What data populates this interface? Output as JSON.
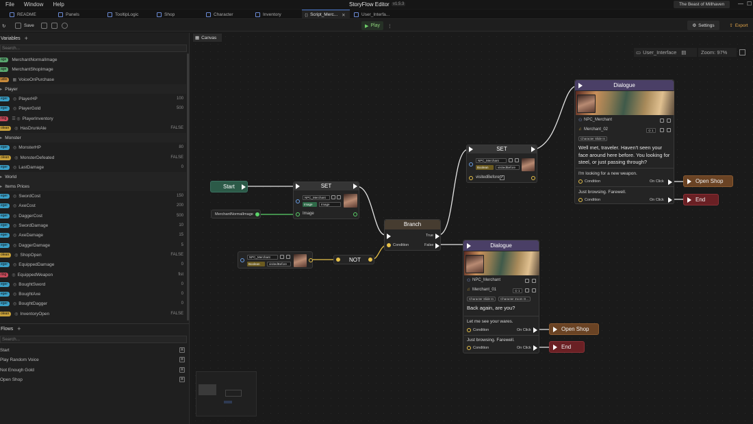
{
  "menu": {
    "file": "File",
    "window": "Window",
    "help": "Help"
  },
  "app": {
    "title": "StoryFlow Editor",
    "version": "v1.5.3",
    "project": "The Beast of Millhaven"
  },
  "tabs": [
    "README",
    "Panels",
    "TooltipLogic",
    "Shop",
    "Character",
    "Inventory",
    "Script_Merc...",
    "User_Interfa..."
  ],
  "toolbar": {
    "save": "Save",
    "play": "Play",
    "settings": "Settings",
    "export": "Export"
  },
  "variables": {
    "title": "Variables",
    "search": "Search...",
    "ungrouped": [
      {
        "type": "age",
        "name": "MerchantNormalImage",
        "value": ""
      },
      {
        "type": "age",
        "name": "MerchantShopImage",
        "value": ""
      },
      {
        "type": "udio",
        "name": "VoiceOnPurchase",
        "value": ""
      }
    ],
    "groups": [
      {
        "name": "Player",
        "items": [
          {
            "type": "eger",
            "name": "PlayerHP",
            "value": "100"
          },
          {
            "type": "eger",
            "name": "PlayerGold",
            "value": "500"
          },
          {
            "type": "ring",
            "name": "PlayerInventory",
            "value": ""
          },
          {
            "type": "olean",
            "name": "HasDrunkAle",
            "value": "FALSE"
          }
        ]
      },
      {
        "name": "Monster",
        "items": [
          {
            "type": "eger",
            "name": "MonsterHP",
            "value": "80"
          },
          {
            "type": "olean",
            "name": "MonsterDefeated",
            "value": "FALSE"
          },
          {
            "type": "eger",
            "name": "LastDamage",
            "value": "0"
          }
        ]
      },
      {
        "name": "World",
        "items": []
      },
      {
        "name": "Items Prices",
        "items": [
          {
            "type": "eger",
            "name": "SwordCost",
            "value": "150"
          },
          {
            "type": "eger",
            "name": "AxeCost",
            "value": "200"
          },
          {
            "type": "eger",
            "name": "DaggerCost",
            "value": "500"
          },
          {
            "type": "eger",
            "name": "SwordDamage",
            "value": "10"
          },
          {
            "type": "eger",
            "name": "AxeDamage",
            "value": "15"
          },
          {
            "type": "eger",
            "name": "DaggerDamage",
            "value": "5"
          },
          {
            "type": "olean",
            "name": "ShopOpen",
            "value": "FALSE"
          },
          {
            "type": "eger",
            "name": "EquippedDamage",
            "value": "0"
          },
          {
            "type": "ring",
            "name": "EquippedWeapon",
            "value": "fist"
          },
          {
            "type": "eger",
            "name": "BoughtSword",
            "value": "0"
          },
          {
            "type": "eger",
            "name": "BoughtAxe",
            "value": "0"
          },
          {
            "type": "eger",
            "name": "BoughtDagger",
            "value": "0"
          },
          {
            "type": "olean",
            "name": "InventoryOpen",
            "value": "FALSE"
          }
        ]
      }
    ]
  },
  "flows": {
    "title": "Flows",
    "search": "Search...",
    "items": [
      "Start",
      "Play Random Voice",
      "Not Enough Gold",
      "Open Shop"
    ]
  },
  "canvas": {
    "tab": "Canvas",
    "breadcrumb": "User_Interface",
    "zoom": "Zoom: 97%"
  },
  "nodes": {
    "start": "Start",
    "set1": {
      "title": "SET",
      "target": "NPC_Merchant",
      "kind": "Image",
      "value": "Image",
      "out": "Image"
    },
    "image_var": "MerchantNormalImage",
    "get_bool": {
      "target": "NPC_Merchant",
      "kind": "Boolean",
      "var": "visitedBefore"
    },
    "not": "NOT",
    "branch": {
      "title": "Branch",
      "true": "True",
      "false": "False",
      "condition": "Condition"
    },
    "set2": {
      "title": "SET",
      "target": "NPC_Merchant",
      "kind": "Boolean",
      "var": "visitedBefore",
      "out": "visitedBefore"
    },
    "dialogue1": {
      "title": "Dialogue",
      "character": "NPC_Merchant",
      "audio": "Merchant_02",
      "tag1": "Character Slide In",
      "text": "Well met, traveler. Haven't seen your face around here before. You looking for steel, or just passing through?",
      "opt1": "I'm looking for a new weapon.",
      "opt2": "Just browsing. Farewell.",
      "cond": "Condition",
      "onclick": "On Click"
    },
    "dialogue2": {
      "title": "Dialogue",
      "character": "NPC_Merchant",
      "audio": "Merchant_01",
      "tag1": "Character Slide In",
      "tag2": "Character Zoom O...",
      "text": "Back again, are you?",
      "opt1": "Let me see your wares.",
      "opt2": "Just browsing. Farewell.",
      "cond": "Condition",
      "onclick": "On Click"
    },
    "out_open1": "Open Shop",
    "out_end1": "End",
    "out_open2": "Open Shop",
    "out_end2": "End"
  },
  "colors": {
    "integer": "#3aa0c8",
    "image": "#5aa870",
    "audio": "#c88a3a",
    "string": "#c84a5a",
    "boolean": "#c8a03a",
    "dialogue_head": "#4a3f66",
    "set_head": "#3a3a3a",
    "branch_head": "#4a3f33",
    "start_head": "#2c5a48"
  }
}
